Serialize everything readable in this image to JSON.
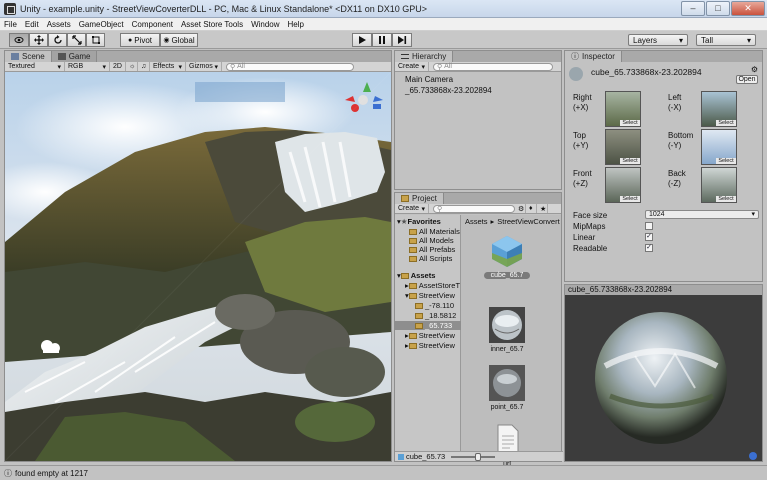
{
  "window": {
    "title": "Unity - example.unity - StreetViewCoverterDLL - PC, Mac & Linux Standalone* <DX11 on DX10 GPU>"
  },
  "menu": [
    "File",
    "Edit",
    "Assets",
    "GameObject",
    "Component",
    "Asset Store Tools",
    "Window",
    "Help"
  ],
  "toolbar": {
    "tools": [
      "hand-icon",
      "move-icon",
      "rotate-icon",
      "scale-icon",
      "rect-icon"
    ],
    "pivot_label": "Pivot",
    "global_label": "Global",
    "play_icon": "play-icon",
    "pause_icon": "pause-icon",
    "step_icon": "step-icon",
    "layers_label": "Layers",
    "layout_label": "Tall"
  },
  "scene": {
    "tabs": [
      "Scene",
      "Game"
    ],
    "shading": "Textured",
    "render": "RGB",
    "mode2d": "2D",
    "effects": "Effects",
    "gizmos": "Gizmos",
    "search_placeholder": "All"
  },
  "hierarchy": {
    "tab": "Hierarchy",
    "create": "Create",
    "search_placeholder": "All",
    "items": [
      "Main Camera",
      "_65.733868x-23.202894"
    ]
  },
  "project": {
    "tab": "Project",
    "create": "Create",
    "favorites_label": "Favorites",
    "favorites": [
      "All Materials",
      "All Models",
      "All Prefabs",
      "All Scripts"
    ],
    "assets_label": "Assets",
    "asset_folders": [
      "AssetStoreT",
      "StreetView"
    ],
    "streetview_children": [
      "_-78.110",
      "_18.5812",
      "_65.733"
    ],
    "more_folders": [
      "StreetView",
      "StreetView"
    ],
    "breadcrumb": [
      "Assets",
      "StreetViewConvert"
    ],
    "assets": [
      "cube_65.7",
      "inner_65.7",
      "point_65.7",
      "url"
    ],
    "footer_label": "cube_65.73"
  },
  "inspector": {
    "tab": "Inspector",
    "object_name": "cube_65.733868x-23.202894",
    "open_button": "Open",
    "faces": [
      {
        "label": "Right",
        "axis": "(+X)"
      },
      {
        "label": "Left",
        "axis": "(-X)"
      },
      {
        "label": "Top",
        "axis": "(+Y)"
      },
      {
        "label": "Bottom",
        "axis": "(-Y)"
      },
      {
        "label": "Front",
        "axis": "(+Z)"
      },
      {
        "label": "Back",
        "axis": "(-Z)"
      }
    ],
    "select_label": "Select",
    "face_size_label": "Face size",
    "face_size_value": "1024",
    "mipmaps_label": "MipMaps",
    "mipmaps": false,
    "linear_label": "Linear",
    "linear": true,
    "readable_label": "Readable",
    "readable": true,
    "preview_title": "cube_65.733868x-23.202894"
  },
  "status": {
    "message": "found empty at 1217"
  }
}
